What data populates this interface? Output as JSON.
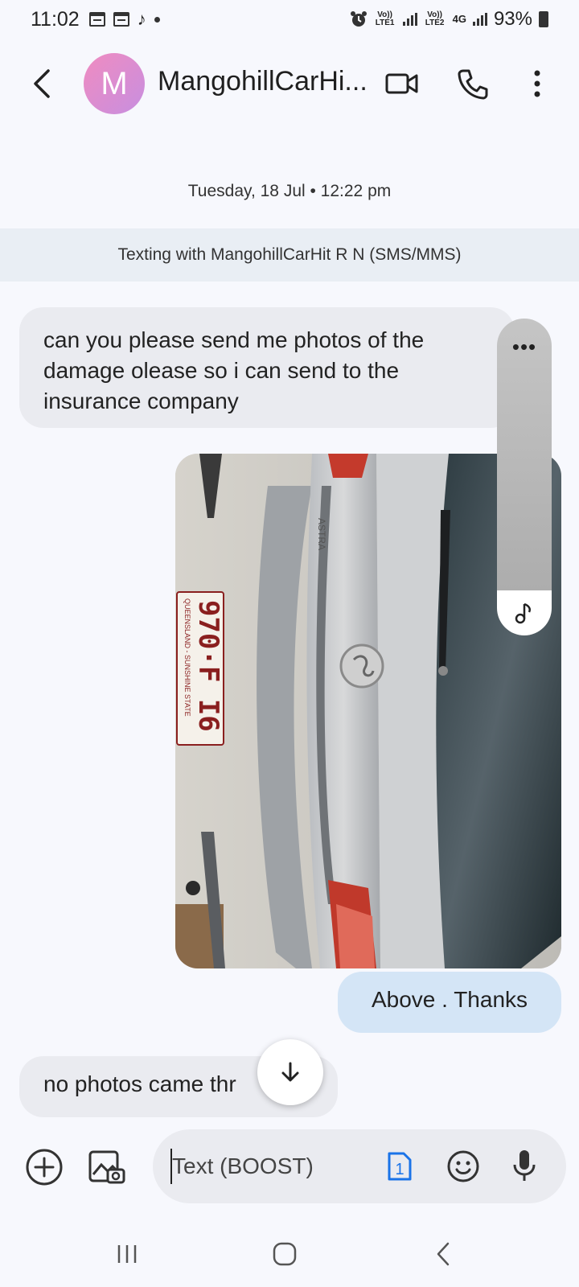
{
  "status_bar": {
    "time": "11:02",
    "sim1_label": "Vo)) LTE1",
    "sim2_label": "Vo)) LTE2",
    "network": "4G",
    "battery": "93%"
  },
  "header": {
    "avatar_letter": "M",
    "contact_name": "MangohillCarHi...",
    "icons": [
      "back-icon",
      "video-call-icon",
      "phone-call-icon",
      "more-options-icon"
    ]
  },
  "conversation": {
    "date": "Tuesday, 18 Jul • 12:22 pm",
    "banner": "Texting with MangohillCarHit R N (SMS/MMS)",
    "messages": [
      {
        "direction": "incoming",
        "text": "can you please send me photos of the damage olease so i can send to the insurance company"
      },
      {
        "direction": "outgoing",
        "type": "image",
        "plate_number": "970·F I6",
        "plate_caption": "QUEENSLAND - SUNSHINE STATE",
        "badge_text": "ASTRA"
      },
      {
        "direction": "outgoing",
        "text": "Above . Thanks"
      },
      {
        "direction": "incoming",
        "text": "no photos came thr"
      }
    ],
    "scroll_handle_dots": "•••"
  },
  "compose": {
    "placeholder": "Text (BOOST)",
    "sim_badge": "1",
    "icons": [
      "add-icon",
      "gallery-icon",
      "sim-icon",
      "emoji-icon",
      "mic-icon"
    ]
  },
  "navbar": {
    "icons": [
      "recent-apps-icon",
      "home-icon",
      "back-nav-icon"
    ]
  },
  "colors": {
    "background": "#f7f8fd",
    "incoming_bubble": "#eaebf0",
    "outgoing_bubble": "#d4e5f6",
    "banner": "#e9eef4",
    "sim_blue": "#1a73e8",
    "avatar_gradient_start": "#f08cc0",
    "avatar_gradient_end": "#c78ee0"
  }
}
